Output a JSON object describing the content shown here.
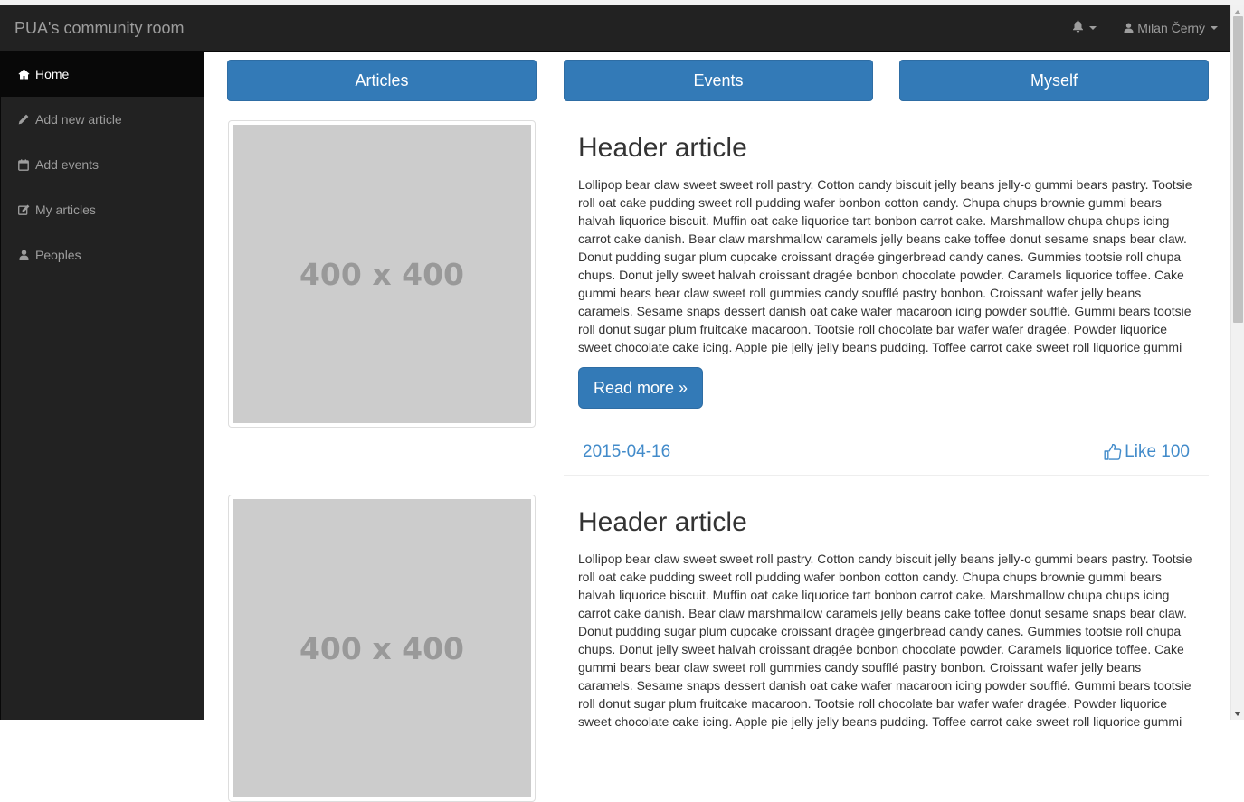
{
  "app": {
    "brand": "PUA's community room"
  },
  "navbar": {
    "user_name": "Milan Černý"
  },
  "sidebar": {
    "items": [
      {
        "label": "Home",
        "icon": "home-icon",
        "active": true
      },
      {
        "label": "Add new article",
        "icon": "pencil-icon",
        "active": false
      },
      {
        "label": "Add events",
        "icon": "calendar-icon",
        "active": false
      },
      {
        "label": "My articles",
        "icon": "edit-icon",
        "active": false
      },
      {
        "label": "Peoples",
        "icon": "user-icon",
        "active": false
      }
    ]
  },
  "tabs": [
    {
      "label": "Articles"
    },
    {
      "label": "Events"
    },
    {
      "label": "Myself"
    }
  ],
  "articles": [
    {
      "image_placeholder": "400 x 400",
      "title": "Header article",
      "body": "Lollipop bear claw sweet sweet roll pastry. Cotton candy biscuit jelly beans jelly-o gummi bears pastry. Tootsie roll oat cake pudding sweet roll pudding wafer bonbon cotton candy. Chupa chups brownie gummi bears halvah liquorice biscuit. Muffin oat cake liquorice tart bonbon carrot cake. Marshmallow chupa chups icing carrot cake danish. Bear claw marshmallow caramels jelly beans cake toffee donut sesame snaps bear claw. Donut pudding sugar plum cupcake croissant dragée gingerbread candy canes. Gummies tootsie roll chupa chups. Donut jelly sweet halvah croissant dragée bonbon chocolate powder. Caramels liquorice toffee. Cake gummi bears bear claw sweet roll gummies candy soufflé pastry bonbon. Croissant wafer jelly beans caramels. Sesame snaps dessert danish oat cake wafer macaroon icing powder soufflé. Gummi bears tootsie roll donut sugar plum fruitcake macaroon. Tootsie roll chocolate bar wafer wafer dragée. Powder liquorice sweet chocolate cake icing. Apple pie jelly jelly beans pudding. Toffee carrot cake sweet roll liquorice gummi",
      "read_more": "Read more »",
      "date": "2015-04-16",
      "like_label": "Like 100"
    },
    {
      "image_placeholder": "400 x 400",
      "title": "Header article",
      "body": "Lollipop bear claw sweet sweet roll pastry. Cotton candy biscuit jelly beans jelly-o gummi bears pastry. Tootsie roll oat cake pudding sweet roll pudding wafer bonbon cotton candy. Chupa chups brownie gummi bears halvah liquorice biscuit. Muffin oat cake liquorice tart bonbon carrot cake. Marshmallow chupa chups icing carrot cake danish. Bear claw marshmallow caramels jelly beans cake toffee donut sesame snaps bear claw. Donut pudding sugar plum cupcake croissant dragée gingerbread candy canes. Gummies tootsie roll chupa chups. Donut jelly sweet halvah croissant dragée bonbon chocolate powder. Caramels liquorice toffee. Cake gummi bears bear claw sweet roll gummies candy soufflé pastry bonbon. Croissant wafer jelly beans caramels. Sesame snaps dessert danish oat cake wafer macaroon icing powder soufflé. Gummi bears tootsie roll donut sugar plum fruitcake macaroon. Tootsie roll chocolate bar wafer wafer dragée. Powder liquorice sweet chocolate cake icing. Apple pie jelly jelly beans pudding. Toffee carrot cake sweet roll liquorice gummi"
    }
  ],
  "colors": {
    "navbar_bg": "#222222",
    "primary": "#337ab7",
    "link": "#428bca",
    "placeholder_bg": "#cccccc"
  }
}
